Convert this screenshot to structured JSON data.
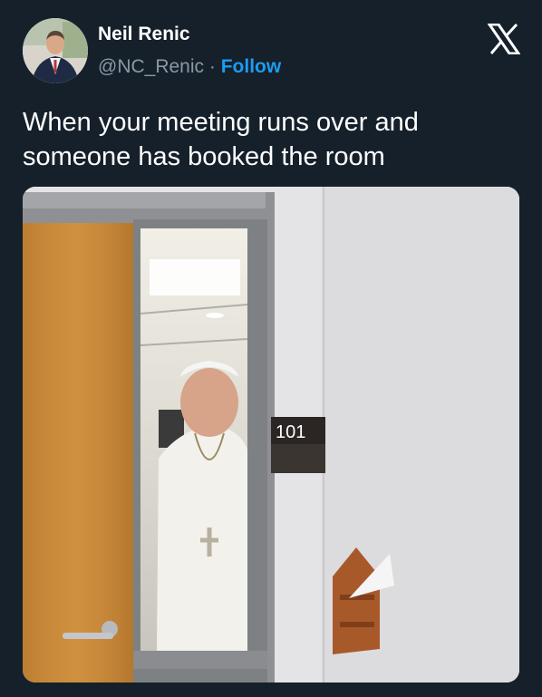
{
  "author": {
    "name": "Neil Renic",
    "handle": "@NC_Renic",
    "separator": "·",
    "follow_label": "Follow"
  },
  "icons": {
    "platform": "x-logo-icon",
    "avatar": "avatar-photo"
  },
  "tweet": {
    "text": "When your meeting runs over and someone has booked the room"
  },
  "media": {
    "room_number_sign": "101"
  },
  "colors": {
    "background": "#15202b",
    "text": "#ffffff",
    "secondary_text": "#8b98a5",
    "accent": "#1d9bf0"
  }
}
